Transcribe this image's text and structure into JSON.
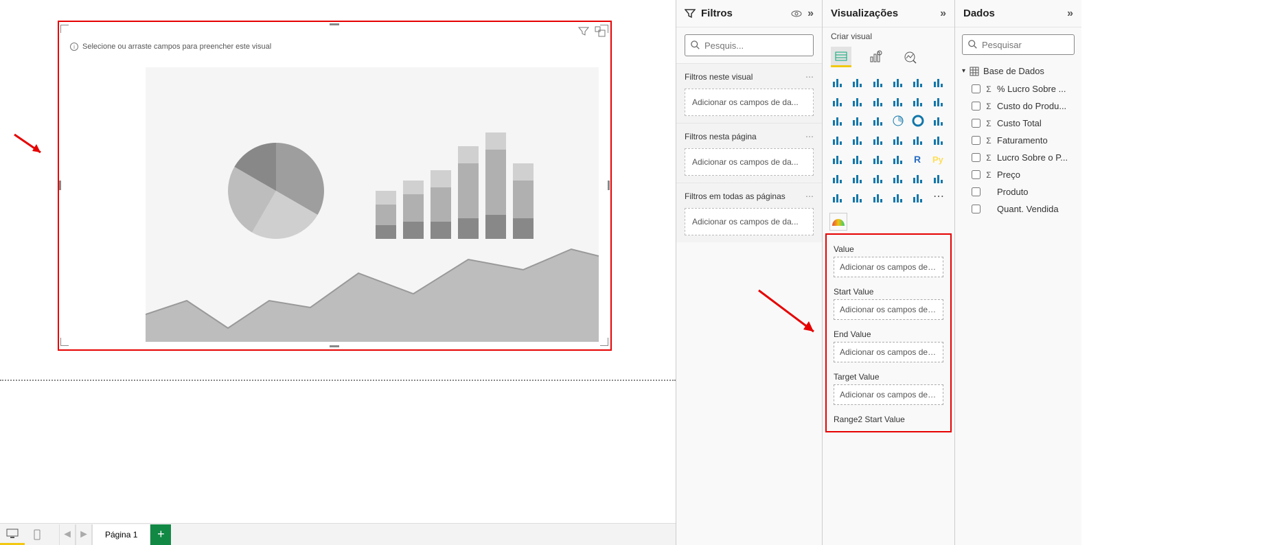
{
  "canvas": {
    "hint_text": "Selecione ou arraste campos para preencher este visual"
  },
  "bottom_bar": {
    "page_tab": "Página 1"
  },
  "filters_pane": {
    "title": "Filtros",
    "search_placeholder": "Pesquis...",
    "section1_title": "Filtros neste visual",
    "section2_title": "Filtros nesta página",
    "section3_title": "Filtros em todas as páginas",
    "add_fields_text": "Adicionar os campos de da..."
  },
  "viz_pane": {
    "title": "Visualizações",
    "subtitle": "Criar visual",
    "field_wells": [
      {
        "label": "Value",
        "placeholder": "Adicionar os campos de da..."
      },
      {
        "label": "Start Value",
        "placeholder": "Adicionar os campos de da..."
      },
      {
        "label": "End Value",
        "placeholder": "Adicionar os campos de da..."
      },
      {
        "label": "Target Value",
        "placeholder": "Adicionar os campos de da..."
      },
      {
        "label": "Range2 Start Value",
        "placeholder": ""
      }
    ]
  },
  "data_pane": {
    "title": "Dados",
    "search_placeholder": "Pesquisar",
    "table_name": "Base de Dados",
    "fields": [
      {
        "name": "% Lucro Sobre ...",
        "aggregate": true
      },
      {
        "name": "Custo do Produ...",
        "aggregate": true
      },
      {
        "name": "Custo Total",
        "aggregate": true
      },
      {
        "name": "Faturamento",
        "aggregate": true
      },
      {
        "name": "Lucro Sobre o P...",
        "aggregate": true
      },
      {
        "name": "Preço",
        "aggregate": true
      },
      {
        "name": "Produto",
        "aggregate": false
      },
      {
        "name": "Quant. Vendida",
        "aggregate": false
      }
    ]
  },
  "viz_icons": [
    "stacked-bar",
    "clustered-bar",
    "stacked-100-bar",
    "clustered-column",
    "stacked-column",
    "stacked-100-column",
    "line",
    "area",
    "stacked-area",
    "line-clustered",
    "line-stacked",
    "ribbon",
    "waterfall",
    "funnel",
    "scatter",
    "pie",
    "donut",
    "treemap",
    "map",
    "filled-map",
    "azure-map",
    "gauge",
    "card",
    "multi-card",
    "kpi",
    "slicer",
    "table",
    "matrix",
    "r",
    "py",
    "key-influencers",
    "decomposition",
    "qna",
    "narrative",
    "paginated",
    "goals",
    "power-automate",
    "apps",
    "globe",
    "shape",
    "arcgis",
    "more"
  ]
}
